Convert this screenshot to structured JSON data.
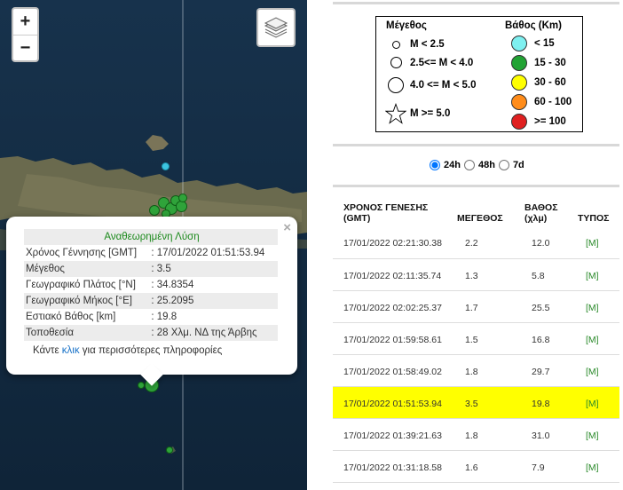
{
  "map": {
    "zoom_in_label": "+",
    "zoom_out_label": "−",
    "popup": {
      "title": "Αναθεωρημένη Λύση",
      "close": "×",
      "rows": [
        {
          "label": "Χρόνος Γέννησης [GMT]",
          "value": ": 17/01/2022 01:51:53.94"
        },
        {
          "label": "Μέγεθος",
          "value": ": 3.5"
        },
        {
          "label": "Γεωγραφικό Πλάτος [°N]",
          "value": ": 34.8354"
        },
        {
          "label": "Γεωγραφικό Μήκος [°E]",
          "value": ": 25.2095"
        },
        {
          "label": "Εστιακό Βάθος [km]",
          "value": ": 19.8"
        },
        {
          "label": "Τοποθεσία",
          "value": ": 28 Χλμ. ΝΔ της Άρβης"
        }
      ],
      "more_prefix": "Κάντε ",
      "more_link": "κλικ",
      "more_suffix": " για περισσότερες πληροφορίες"
    }
  },
  "legend": {
    "magnitude_title": "Μέγεθος",
    "magnitude_items": [
      "M < 2.5",
      "2.5<= M < 4.0",
      "4.0 <= M < 5.0",
      "M >= 5.0"
    ],
    "depth_title": "Βάθος (Km)",
    "depth_items": [
      {
        "label": "< 15",
        "color": "#7ef0f0"
      },
      {
        "label": "15 - 30",
        "color": "#22a334"
      },
      {
        "label": "30 - 60",
        "color": "#ffff00"
      },
      {
        "label": "60 - 100",
        "color": "#ff8c1a"
      },
      {
        "label": ">= 100",
        "color": "#e02020"
      }
    ]
  },
  "time_filter": {
    "options": [
      "24h",
      "48h",
      "7d"
    ],
    "selected": "24h"
  },
  "table": {
    "headers": {
      "time_line1": "ΧΡΟΝΟΣ ΓΕΝΕΣΗΣ",
      "time_line2": "(GMT)",
      "magnitude": "ΜΕΓΕΘΟΣ",
      "depth_line1": "ΒΑΘΟΣ",
      "depth_line2": "(χλμ)",
      "type": "ΤΥΠΟΣ"
    },
    "rows": [
      {
        "time": "17/01/2022 02:21:30.38",
        "mag": "2.2",
        "depth": "12.0",
        "type": "[M]"
      },
      {
        "time": "17/01/2022 02:11:35.74",
        "mag": "1.3",
        "depth": "5.8",
        "type": "[M]"
      },
      {
        "time": "17/01/2022 02:02:25.37",
        "mag": "1.7",
        "depth": "25.5",
        "type": "[M]"
      },
      {
        "time": "17/01/2022 01:59:58.61",
        "mag": "1.5",
        "depth": "16.8",
        "type": "[M]"
      },
      {
        "time": "17/01/2022 01:58:49.02",
        "mag": "1.8",
        "depth": "29.7",
        "type": "[M]"
      },
      {
        "time": "17/01/2022 01:51:53.94",
        "mag": "3.5",
        "depth": "19.8",
        "type": "[M]",
        "highlight": true
      },
      {
        "time": "17/01/2022 01:39:21.63",
        "mag": "1.8",
        "depth": "31.0",
        "type": "[M]"
      },
      {
        "time": "17/01/2022 01:31:18.58",
        "mag": "1.6",
        "depth": "7.9",
        "type": "[M]"
      }
    ]
  }
}
